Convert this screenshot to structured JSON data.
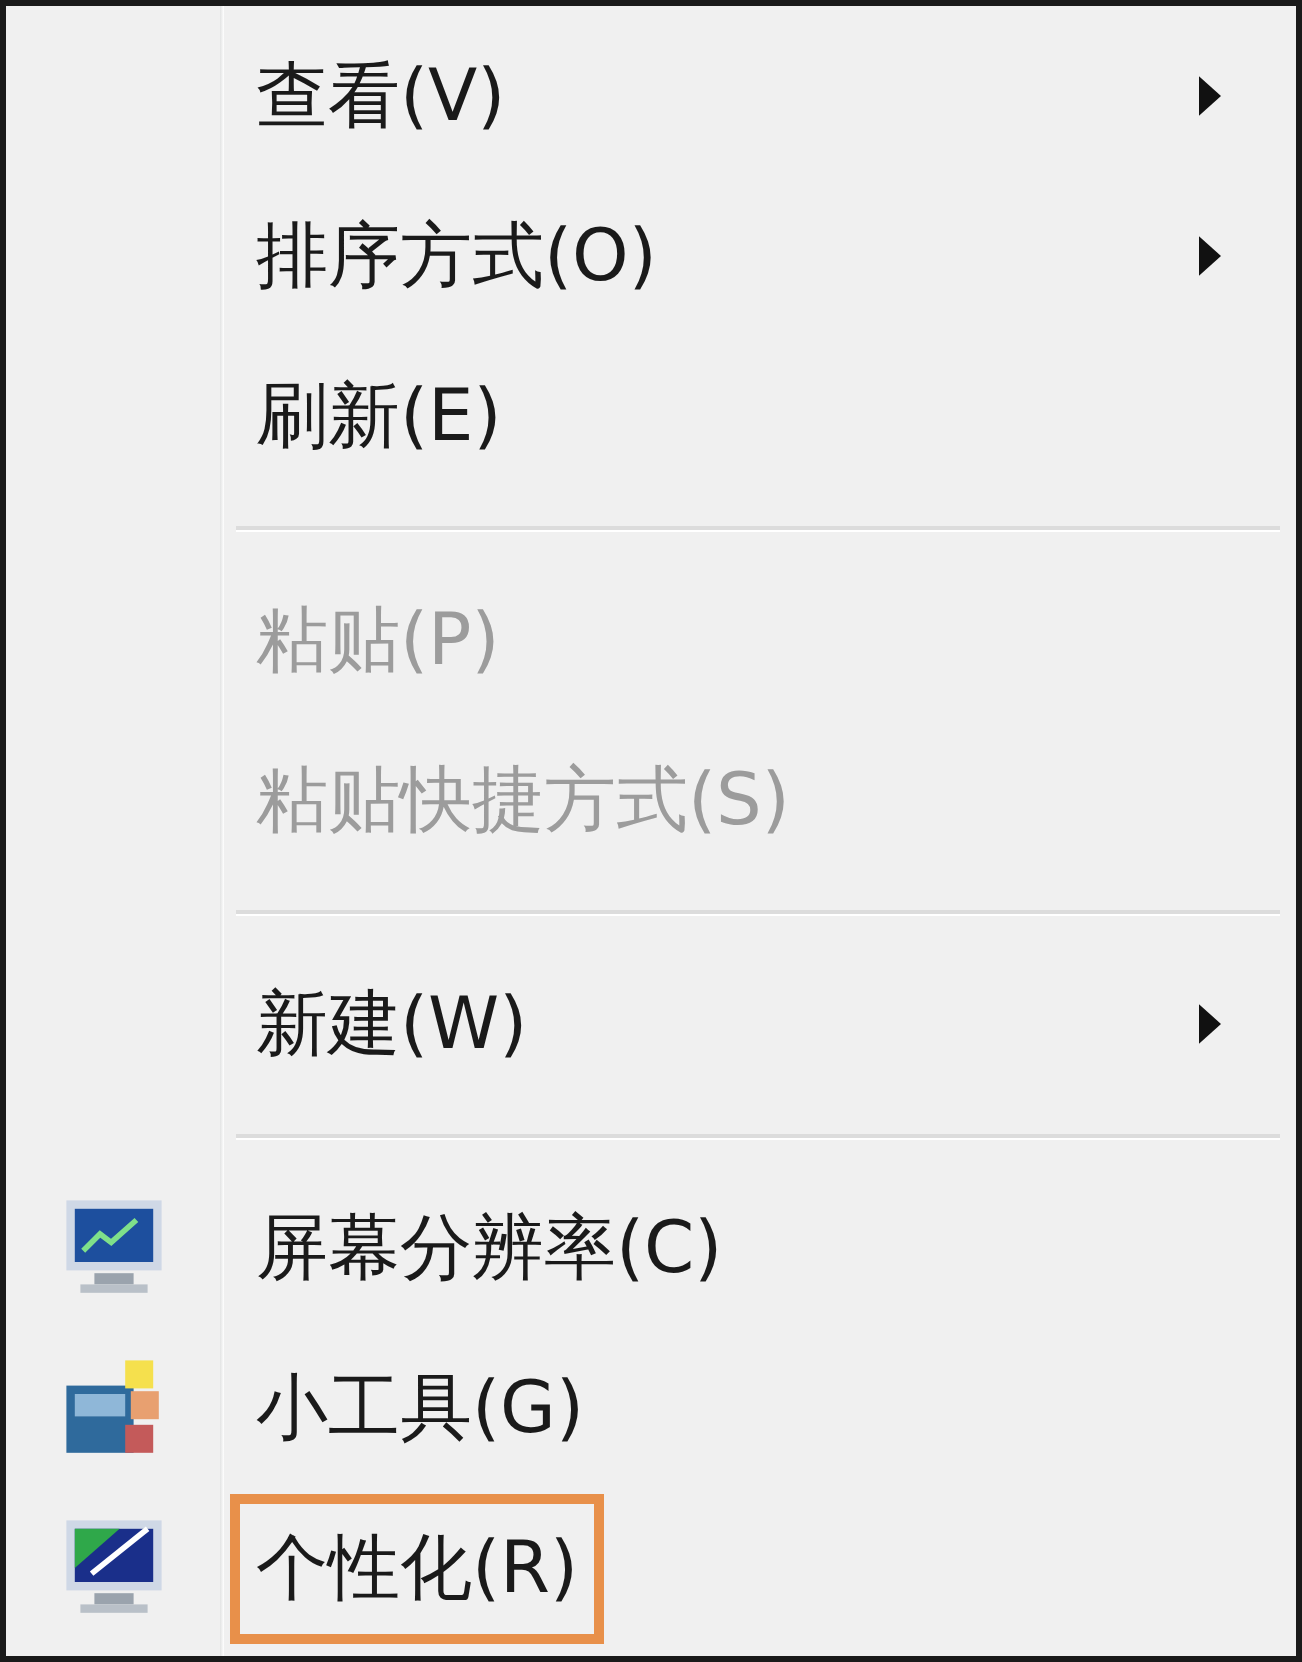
{
  "menu": {
    "items": [
      {
        "kind": "item",
        "label": "查看(V)",
        "disabled": false,
        "submenu": true,
        "highlighted": false
      },
      {
        "kind": "item",
        "label": "排序方式(O)",
        "disabled": false,
        "submenu": true,
        "highlighted": false
      },
      {
        "kind": "item",
        "label": "刷新(E)",
        "disabled": false,
        "submenu": false,
        "highlighted": false
      },
      {
        "kind": "separator"
      },
      {
        "kind": "item",
        "label": "粘贴(P)",
        "disabled": true,
        "submenu": false,
        "highlighted": false
      },
      {
        "kind": "item",
        "label": "粘贴快捷方式(S)",
        "disabled": true,
        "submenu": false,
        "highlighted": false
      },
      {
        "kind": "separator"
      },
      {
        "kind": "item",
        "label": "新建(W)",
        "disabled": false,
        "submenu": true,
        "highlighted": false
      },
      {
        "kind": "separator"
      },
      {
        "kind": "display",
        "label": "屏幕分辨率(C)",
        "disabled": false,
        "submenu": false,
        "highlighted": false
      },
      {
        "kind": "gadgets",
        "label": "小工具(G)",
        "disabled": false,
        "submenu": false,
        "highlighted": false
      },
      {
        "kind": "personalize",
        "label": "个性化(R)",
        "disabled": false,
        "submenu": false,
        "highlighted": true
      }
    ]
  }
}
